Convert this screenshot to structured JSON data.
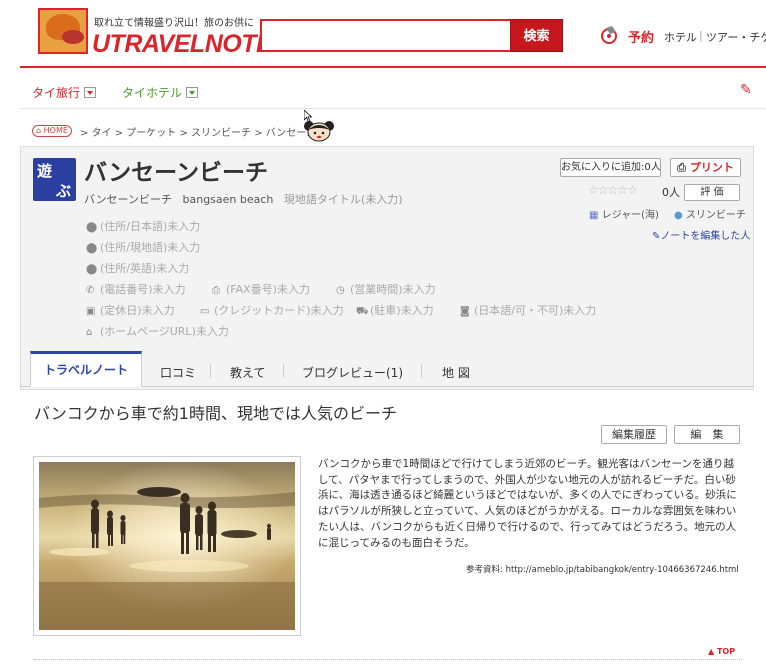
{
  "header": {
    "tagline": "取れ立て情報盛り沢山！旅のお供に",
    "logo_text": "UTRAVELNOTE",
    "search_value": "",
    "search_button": "検索",
    "reserve_label": "予約",
    "links": [
      "ホテル",
      "ツアー・チケ"
    ]
  },
  "nav": {
    "items": [
      "タイ旅行",
      "タイホテル"
    ],
    "colors": {
      "tai_travel": "#d9262c",
      "tai_hotel": "#4a9a2a"
    }
  },
  "breadcrumb": {
    "home": "HOME",
    "path": "> タイ > プーケット > スリンビーチ > バンセーン"
  },
  "spot": {
    "category_chars": [
      "遊",
      "ぶ"
    ],
    "title": "バンセーンビーチ",
    "subtitle_jp": "バンセーンビーチ",
    "subtitle_en": "bangsaen beach",
    "subtitle_local": "現地語タイトル(未入力)",
    "favorite_button": "お気に入りに追加:0人",
    "print_button": "プリント",
    "rating_count": "0人",
    "rate_button": "評 価",
    "tag_category": "レジャー(海)",
    "tag_area": "スリンビーチ",
    "edit_people": "ノートを編集した人",
    "info": {
      "address_jp": "(住所/日本語)未入力",
      "address_local": "(住所/現地語)未入力",
      "address_en": "(住所/英語)未入力",
      "phone": "(電話番号)未入力",
      "fax": "(FAX番号)未入力",
      "hours": "(営業時間)未入力",
      "holiday": "(定休日)未入力",
      "credit": "(クレジットカード)未入力",
      "parking": "(駐車)未入力",
      "japanese": "(日本語/可・不可)未入力",
      "homepage": "(ホームページURL)未入力"
    }
  },
  "tabs": [
    "トラベルノート",
    "口コミ",
    "教えて",
    "ブログレビュー(1)",
    "地 図"
  ],
  "content": {
    "title": "バンコクから車で約1時間、現地では人気のビーチ",
    "history_button": "編集履歴",
    "edit_button": "編　集",
    "body": "バンコクから車で1時間ほどで行けてしまう近郊のビーチ。観光客はバンセーンを通り越して、パタヤまで行ってしまうので、外国人が少ない地元の人が訪れるビーチだ。白い砂浜に、海は透き通るほど綺麗というほどではないが、多くの人でにぎわっている。砂浜にはパラソルが所狭しと立っていて、人気のほどがうかがえる。ローカルな雰囲気を味わいたい人は、バンコクからも近く日帰りで行けるので、行ってみてはどうだろう。地元の人に混じってみるのも面白そうだ。",
    "reference": "参考資料: http://ameblo.jp/tabibangkok/entry-10466367246.html",
    "top_link": "▲ TOP"
  }
}
